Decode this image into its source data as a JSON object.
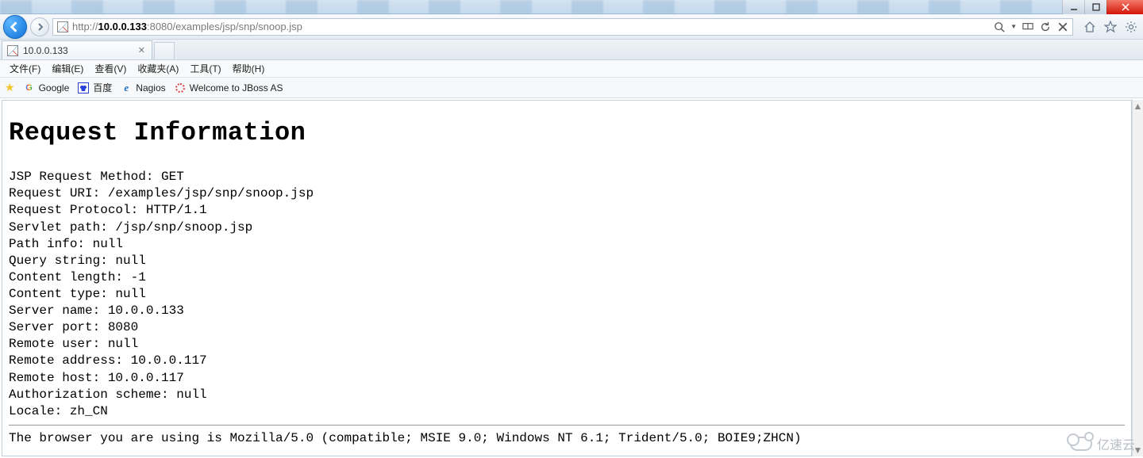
{
  "address": {
    "scheme": "http://",
    "host": "10.0.0.133",
    "port_path": ":8080/examples/jsp/snp/snoop.jsp"
  },
  "tab": {
    "title": "10.0.0.133"
  },
  "menu": {
    "file": "文件(F)",
    "edit": "编辑(E)",
    "view": "查看(V)",
    "favorites": "收藏夹(A)",
    "tools": "工具(T)",
    "help": "帮助(H)"
  },
  "favbar": {
    "google": "Google",
    "baidu": "百度",
    "nagios": "Nagios",
    "jboss": "Welcome to JBoss AS"
  },
  "page": {
    "heading": "Request Information",
    "lines": {
      "l0": "JSP Request Method: GET",
      "l1": "Request URI: /examples/jsp/snp/snoop.jsp",
      "l2": "Request Protocol: HTTP/1.1",
      "l3": "Servlet path: /jsp/snp/snoop.jsp",
      "l4": "Path info: null",
      "l5": "Query string: null",
      "l6": "Content length: -1",
      "l7": "Content type: null",
      "l8": "Server name: 10.0.0.133",
      "l9": "Server port: 8080",
      "l10": "Remote user: null",
      "l11": "Remote address: 10.0.0.117",
      "l12": "Remote host: 10.0.0.117",
      "l13": "Authorization scheme: null",
      "l14": "Locale: zh_CN"
    },
    "ua": "The browser you are using is Mozilla/5.0 (compatible; MSIE 9.0; Windows NT 6.1; Trident/5.0; BOIE9;ZHCN)"
  },
  "watermark": "亿速云"
}
